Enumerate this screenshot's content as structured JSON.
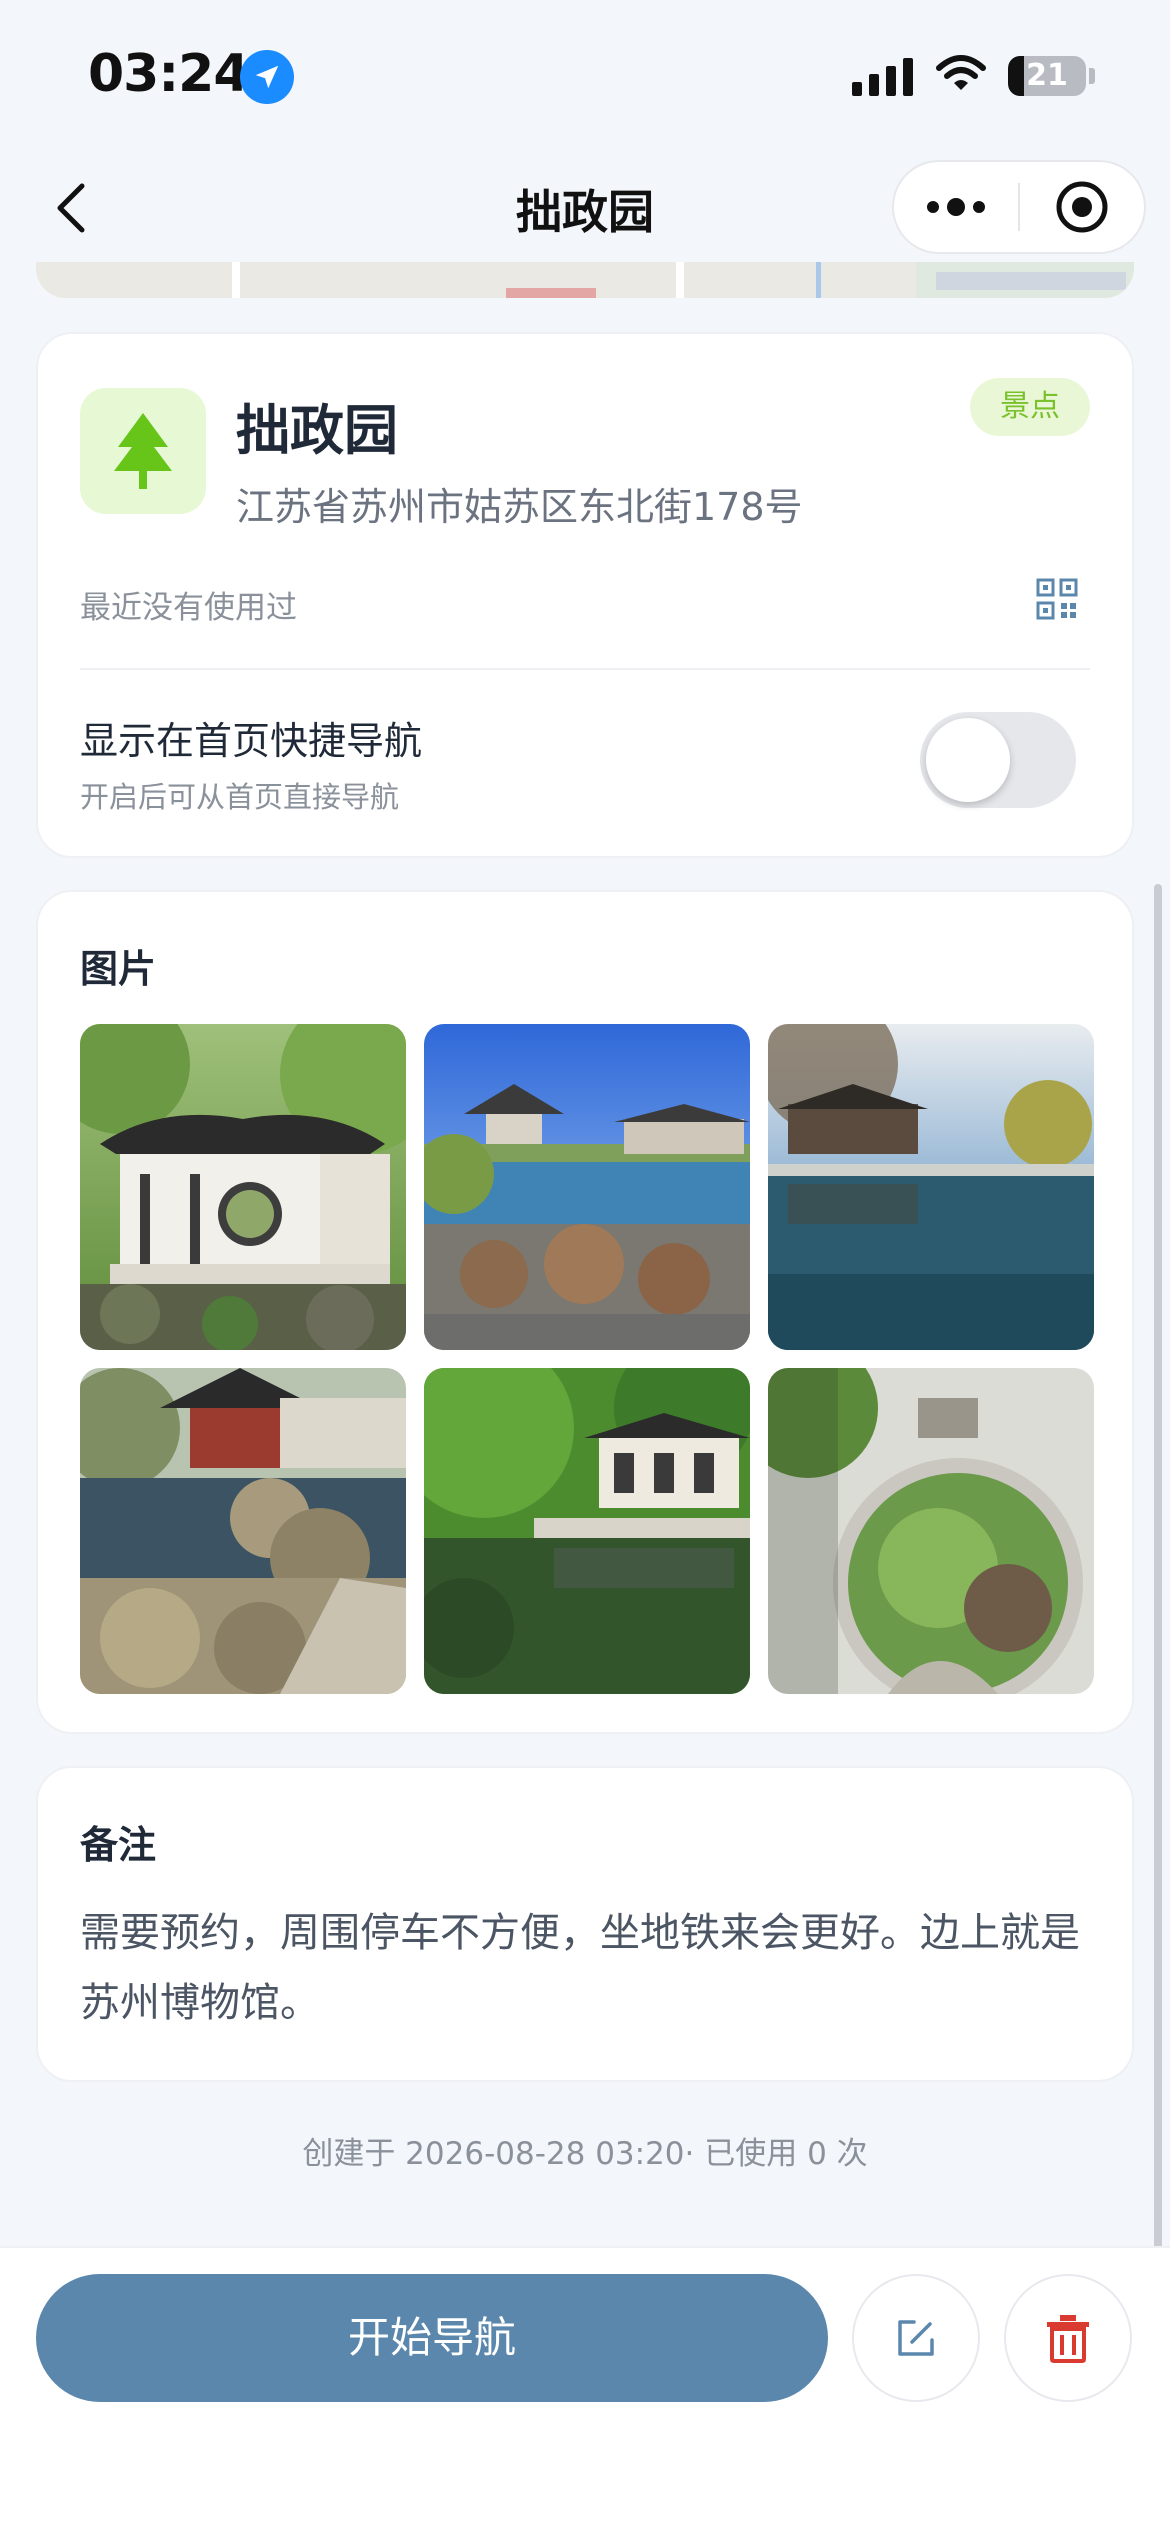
{
  "status_bar": {
    "time": "03:24",
    "battery": "21",
    "battery_level": 0.21
  },
  "nav": {
    "title": "拙政园"
  },
  "place": {
    "name": "拙政园",
    "address": "江苏省苏州市姑苏区东北街178号",
    "category": "景点",
    "icon": "tree-icon",
    "last_used": "最近没有使用过"
  },
  "shortcut": {
    "title": "显示在首页快捷导航",
    "subtitle": "开启后可从首页直接导航",
    "enabled": false
  },
  "photos": {
    "title": "图片",
    "items": [
      {
        "name": "pavilion-round-window"
      },
      {
        "name": "pond-pagoda-blue-sky"
      },
      {
        "name": "water-reflection-terrace"
      },
      {
        "name": "red-pavilion-rockery"
      },
      {
        "name": "green-garden-reflection"
      },
      {
        "name": "moon-gate"
      }
    ]
  },
  "notes": {
    "title": "备注",
    "text": "需要预约，周围停车不方便，坐地铁来会更好。边上就是苏州博物馆。"
  },
  "meta": {
    "footer": "创建于 2026-08-28 03:20· 已使用 0 次"
  },
  "actions": {
    "start_label": "开始导航"
  },
  "colors": {
    "accent": "#5b87ad",
    "tag_green": "#7ac12c",
    "delete_red": "#d93b30"
  }
}
